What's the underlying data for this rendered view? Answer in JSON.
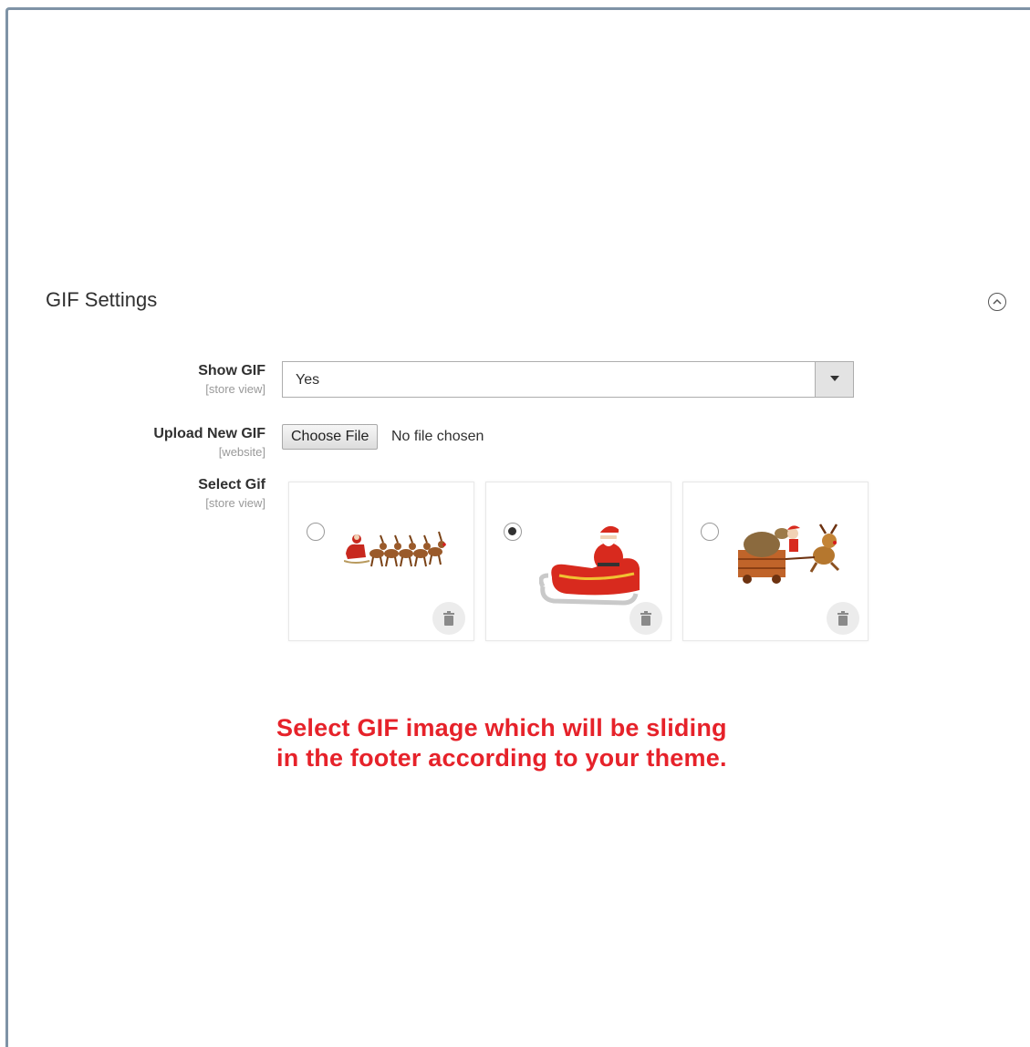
{
  "section": {
    "title": "GIF Settings",
    "collapse_icon": "chevron-up-circle-icon"
  },
  "fields": {
    "show_gif": {
      "label": "Show GIF",
      "scope": "[store view]",
      "selected": "Yes"
    },
    "upload_gif": {
      "label": "Upload New GIF",
      "scope": "[website]",
      "button_label": "Choose File",
      "status": "No file chosen"
    },
    "select_gif": {
      "label": "Select Gif",
      "scope": "[store view]",
      "options": [
        {
          "image": "santa-sleigh-reindeer-team-image",
          "selected": false
        },
        {
          "image": "santa-in-sleigh-image",
          "selected": true
        },
        {
          "image": "reindeer-pulling-gift-cart-image",
          "selected": false
        }
      ]
    }
  },
  "note": {
    "line1": "Select GIF image which will be sliding",
    "line2": "in the footer according to your theme.",
    "color": "#e6222a"
  },
  "colors": {
    "frame": "#7f93a6",
    "text": "#303030",
    "scope": "#999999"
  }
}
